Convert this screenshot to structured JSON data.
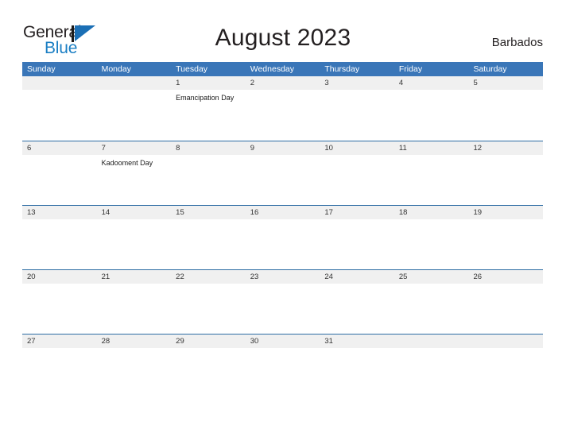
{
  "brand": {
    "name_part1": "General",
    "name_part2": "Blue",
    "mark_icon": "triangle-flag-icon",
    "mark_color": "#1b6fb5",
    "text_color": "#231f20",
    "accent_color": "#1b7fc4"
  },
  "header": {
    "title": "August 2023",
    "region": "Barbados"
  },
  "colors": {
    "header_bar": "#3a76b8",
    "row_border": "#2e6da4",
    "number_band": "#f0f0f0",
    "page_background": "#ffffff",
    "text": "#231f20"
  },
  "calendar": {
    "month": "August",
    "year": "2023",
    "weekday_headers": [
      "Sunday",
      "Monday",
      "Tuesday",
      "Wednesday",
      "Thursday",
      "Friday",
      "Saturday"
    ],
    "weeks": [
      {
        "days": [
          {
            "number": "",
            "event": ""
          },
          {
            "number": "",
            "event": ""
          },
          {
            "number": "1",
            "event": "Emancipation Day"
          },
          {
            "number": "2",
            "event": ""
          },
          {
            "number": "3",
            "event": ""
          },
          {
            "number": "4",
            "event": ""
          },
          {
            "number": "5",
            "event": ""
          }
        ]
      },
      {
        "days": [
          {
            "number": "6",
            "event": ""
          },
          {
            "number": "7",
            "event": "Kadooment Day"
          },
          {
            "number": "8",
            "event": ""
          },
          {
            "number": "9",
            "event": ""
          },
          {
            "number": "10",
            "event": ""
          },
          {
            "number": "11",
            "event": ""
          },
          {
            "number": "12",
            "event": ""
          }
        ]
      },
      {
        "days": [
          {
            "number": "13",
            "event": ""
          },
          {
            "number": "14",
            "event": ""
          },
          {
            "number": "15",
            "event": ""
          },
          {
            "number": "16",
            "event": ""
          },
          {
            "number": "17",
            "event": ""
          },
          {
            "number": "18",
            "event": ""
          },
          {
            "number": "19",
            "event": ""
          }
        ]
      },
      {
        "days": [
          {
            "number": "20",
            "event": ""
          },
          {
            "number": "21",
            "event": ""
          },
          {
            "number": "22",
            "event": ""
          },
          {
            "number": "23",
            "event": ""
          },
          {
            "number": "24",
            "event": ""
          },
          {
            "number": "25",
            "event": ""
          },
          {
            "number": "26",
            "event": ""
          }
        ]
      },
      {
        "days": [
          {
            "number": "27",
            "event": ""
          },
          {
            "number": "28",
            "event": ""
          },
          {
            "number": "29",
            "event": ""
          },
          {
            "number": "30",
            "event": ""
          },
          {
            "number": "31",
            "event": ""
          },
          {
            "number": "",
            "event": ""
          },
          {
            "number": "",
            "event": ""
          }
        ]
      }
    ]
  }
}
